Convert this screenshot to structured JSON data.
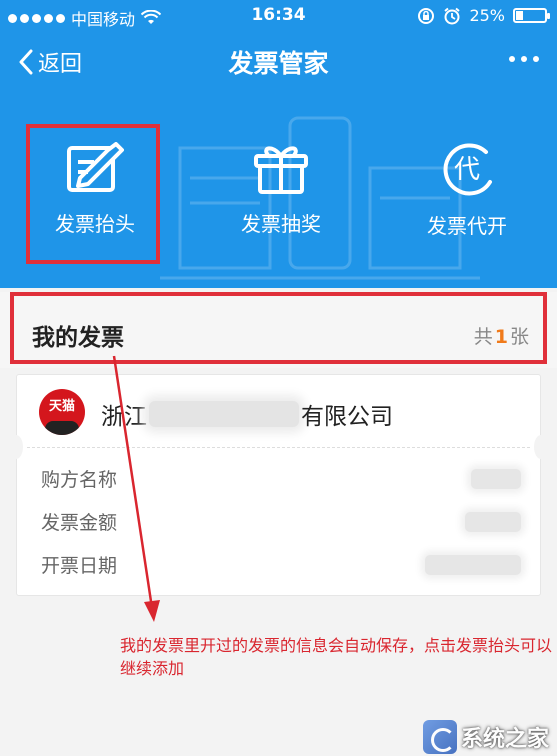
{
  "status_bar": {
    "carrier": "中国移动",
    "time": "16:34",
    "battery": "25%",
    "battery_level": 0.25
  },
  "nav": {
    "back_label": "返回",
    "title": "发票管家"
  },
  "features": [
    {
      "label": "发票抬头",
      "icon": "edit-document-icon"
    },
    {
      "label": "发票抽奖",
      "icon": "gift-icon"
    },
    {
      "label": "发票代开",
      "icon": "proxy-issue-icon",
      "icon_text": "代"
    }
  ],
  "my_invoices": {
    "title": "我的发票",
    "count_prefix": "共",
    "count": "1",
    "count_suffix": "张"
  },
  "invoice_card": {
    "logo_text": "天猫",
    "company_prefix": "浙江",
    "company_suffix": "有限公司",
    "rows": [
      {
        "label": "购方名称"
      },
      {
        "label": "发票金额"
      },
      {
        "label": "开票日期"
      }
    ]
  },
  "annotation": "我的发票里开过的发票的信息会自动保存，点击发票抬头可以继续添加",
  "watermark": {
    "text": "系统之家"
  },
  "colors": {
    "header_blue": "#1f95e8",
    "highlight_red": "#e0303a",
    "count_orange": "#f07a1a",
    "annotation_red": "#d9262f"
  }
}
